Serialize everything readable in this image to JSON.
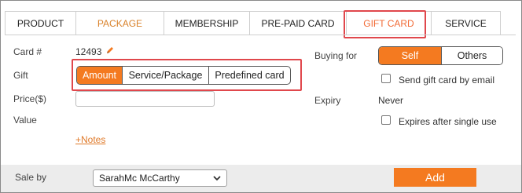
{
  "tabs": [
    "PRODUCT",
    "PACKAGE",
    "MEMBERSHIP",
    "PRE-PAID CARD",
    "GIFT CARD",
    "SERVICE"
  ],
  "form": {
    "card_label": "Card #",
    "card_number": "12493",
    "gift_label": "Gift",
    "gift_options": [
      "Amount",
      "Service/Package",
      "Predefined card"
    ],
    "gift_selected": "Amount",
    "price_label": "Price($)",
    "price_value": "",
    "value_label": "Value",
    "notes_link": "+Notes",
    "buying_for_label": "Buying for",
    "buying_for_options": [
      "Self",
      "Others"
    ],
    "buying_for_selected": "Self",
    "send_email_label": "Send gift card by email",
    "send_email_checked": false,
    "expiry_label": "Expiry",
    "expiry_value": "Never",
    "single_use_label": "Expires after single use",
    "single_use_checked": false
  },
  "footer": {
    "sale_by_label": "Sale by",
    "sale_by_value": "SarahMc McCarthy",
    "add_label": "Add"
  },
  "colors": {
    "accent": "#f47a20",
    "highlight_box": "#e0474c",
    "tab_orange": "#d9822b",
    "footer_bg": "#ececec"
  },
  "icons": [
    "pencil-icon",
    "chevron-down-icon"
  ]
}
